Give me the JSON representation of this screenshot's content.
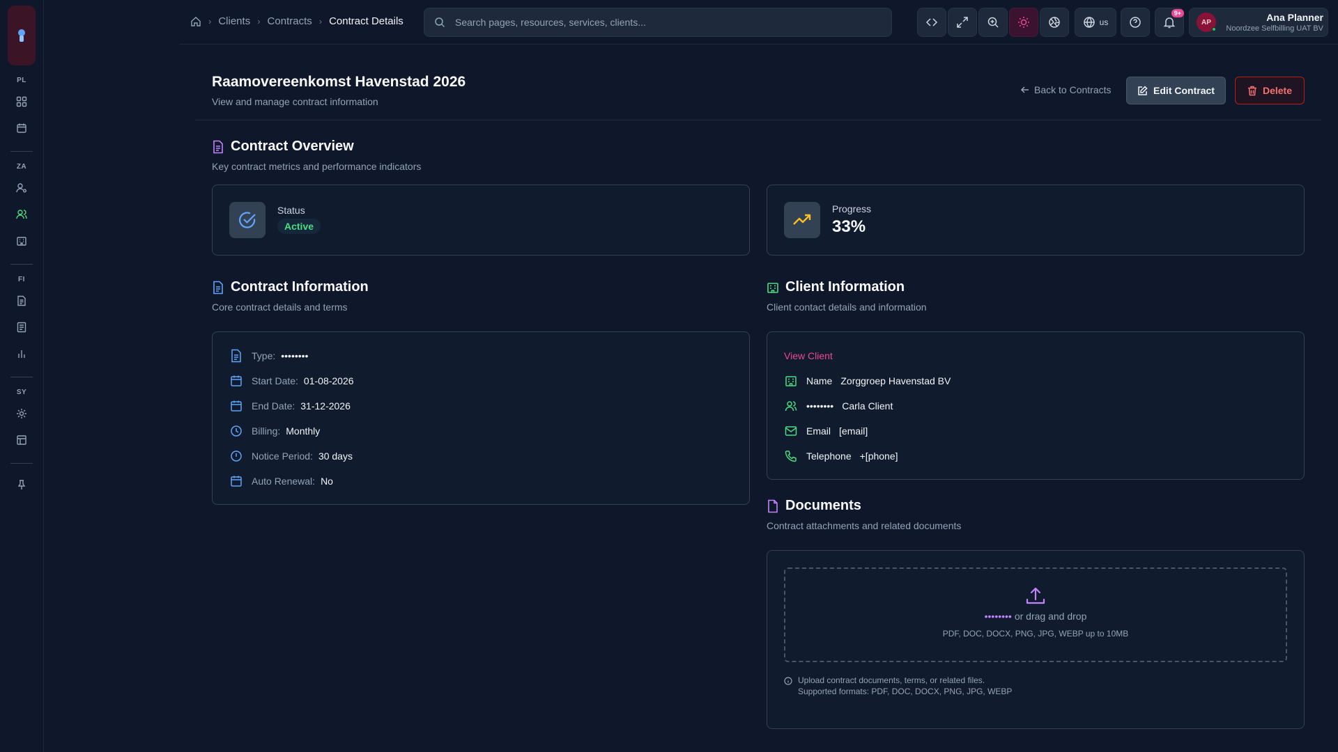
{
  "sidebar": {
    "sections": [
      "PL",
      "ZA",
      "FI",
      "SY"
    ]
  },
  "breadcrumb": {
    "items": [
      "Clients",
      "Contracts"
    ],
    "current": "Contract Details"
  },
  "search": {
    "placeholder": "Search pages, resources, services, clients..."
  },
  "topbar": {
    "language": "us",
    "notifications_badge": "9+"
  },
  "user": {
    "initials": "AP",
    "name": "Ana Planner",
    "org": "Noordzee Selfbilling UAT BV"
  },
  "page": {
    "title": "Raamovereenkomst Havenstad 2026",
    "subtitle": "View and manage contract information",
    "back_label": "Back to Contracts",
    "edit_label": "Edit Contract",
    "delete_label": "Delete"
  },
  "overview": {
    "title": "Contract Overview",
    "subtitle": "Key contract metrics and performance indicators",
    "status_label": "Status",
    "status_value": "Active",
    "progress_label": "Progress",
    "progress_value": "33%"
  },
  "contract_info": {
    "title": "Contract Information",
    "subtitle": "Core contract details and terms",
    "rows": [
      {
        "label": "Type:",
        "value": "••••••••"
      },
      {
        "label": "Start Date:",
        "value": "01-08-2026"
      },
      {
        "label": "End Date:",
        "value": "31-12-2026"
      },
      {
        "label": "Billing:",
        "value": "Monthly"
      },
      {
        "label": "Notice Period:",
        "value": "30 days"
      },
      {
        "label": "Auto Renewal:",
        "value": "No"
      }
    ]
  },
  "client_info": {
    "title": "Client Information",
    "subtitle": "Client contact details and information",
    "view_client": "View Client",
    "rows": [
      {
        "label": "Name",
        "value": "Zorggroep Havenstad BV"
      },
      {
        "label": "••••••••",
        "value": "Carla Client"
      },
      {
        "label": "Email",
        "value": "[email]"
      },
      {
        "label": "Telephone",
        "value": "+[phone]"
      }
    ]
  },
  "documents": {
    "title": "Documents",
    "subtitle": "Contract attachments and related documents",
    "upload_link": "••••••••",
    "upload_text": "or drag and drop",
    "formats": "PDF, DOC, DOCX, PNG, JPG, WEBP up to 10MB",
    "note_line1": "Upload contract documents, terms, or related files.",
    "note_line2": "Supported formats: PDF, DOC, DOCX, PNG, JPG, WEBP"
  },
  "colors": {
    "accent": "#ec4899",
    "success": "#4ade80",
    "danger": "#f87171",
    "info": "#60a5fa",
    "warning": "#fbbf24",
    "purple": "#c084fc",
    "client_icon": "#4ade80"
  }
}
